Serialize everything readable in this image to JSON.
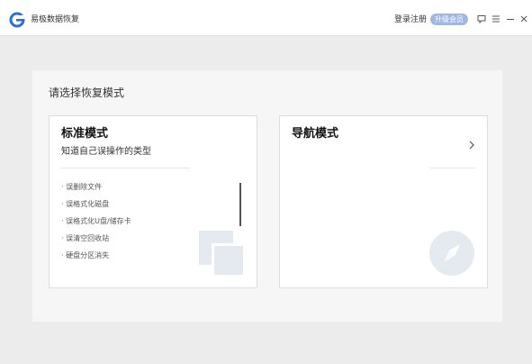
{
  "titlebar": {
    "app_title": "易极数据恢复",
    "login_label": "登录注册",
    "vip_label": "升级会员",
    "icons": [
      "logo-icon",
      "feedback-icon",
      "menu-icon",
      "minimize-icon",
      "close-icon"
    ]
  },
  "colors": {
    "brand": "#2a6fdb",
    "vip_badge": "#9fb7e3",
    "background": "#ececec",
    "panel": "#f6f6f6",
    "decor": "#e4eaf0"
  },
  "main": {
    "heading": "请选择恢复模式",
    "modes": [
      {
        "title": "标准模式",
        "subtitle": "知道自己误操作的类型",
        "items": [
          "· 误删除文件",
          "· 误格式化磁盘",
          "· 误格式化U盘/储存卡",
          "· 误清空回收站",
          "· 硬盘分区消失"
        ],
        "icon": "copy-icon"
      },
      {
        "title": "导航模式",
        "icon": "compass-icon",
        "arrow_icon": "chevron-right-icon"
      }
    ]
  }
}
